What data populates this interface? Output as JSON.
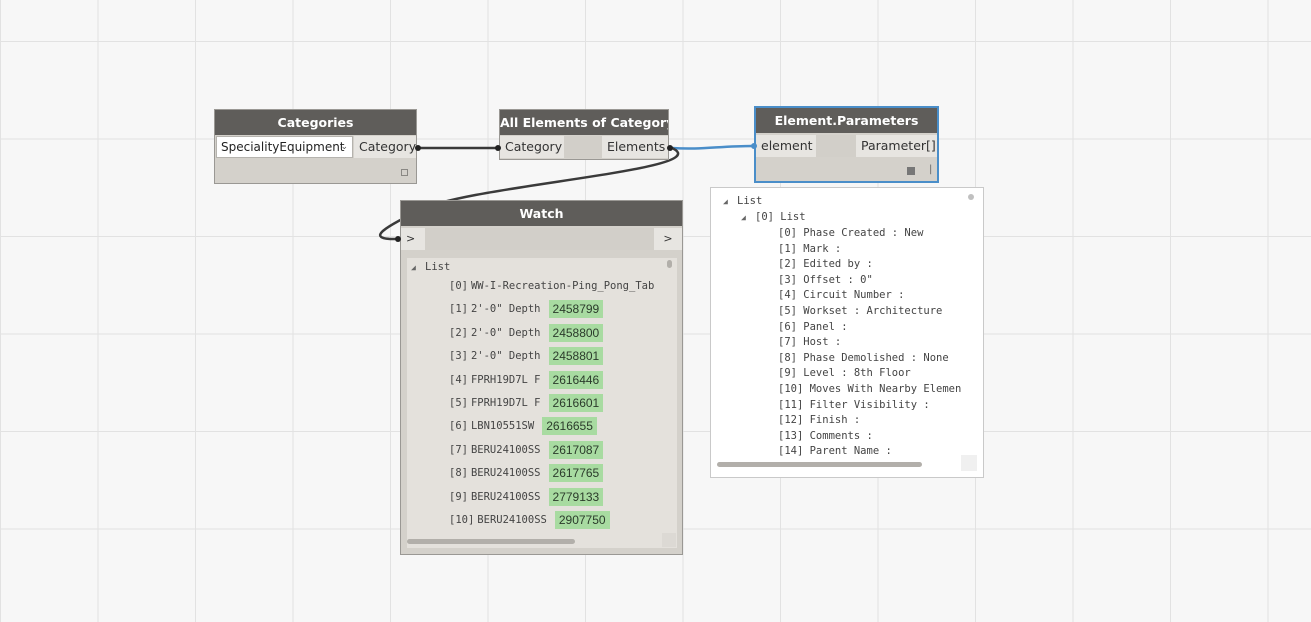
{
  "nodes": {
    "categories": {
      "title": "Categories",
      "dropdown_value": "SpecialityEquipment",
      "output_port": "Category"
    },
    "all_elements": {
      "title": "All Elements of Category",
      "input_port": "Category",
      "output_port": "Elements"
    },
    "element_parameters": {
      "title": "Element.Parameters",
      "input_port": "element",
      "output_port": "Parameter[]",
      "bar_glyph": "|"
    },
    "watch": {
      "title": "Watch",
      "input_port": ">",
      "output_port": ">",
      "list_header": "List",
      "items": [
        {
          "index": "[0]",
          "label": "WW-I-Recreation-Ping_Pong_Tab",
          "id": ""
        },
        {
          "index": "[1]",
          "label": "2'-0\" Depth",
          "id": "2458799"
        },
        {
          "index": "[2]",
          "label": "2'-0\" Depth",
          "id": "2458800"
        },
        {
          "index": "[3]",
          "label": "2'-0\" Depth",
          "id": "2458801"
        },
        {
          "index": "[4]",
          "label": "FPRH19D7L F",
          "id": "2616446"
        },
        {
          "index": "[5]",
          "label": "FPRH19D7L F",
          "id": "2616601"
        },
        {
          "index": "[6]",
          "label": "LBN10551SW",
          "id": "2616655"
        },
        {
          "index": "[7]",
          "label": "BERU24100SS",
          "id": "2617087"
        },
        {
          "index": "[8]",
          "label": "BERU24100SS",
          "id": "2617765"
        },
        {
          "index": "[9]",
          "label": "BERU24100SS",
          "id": "2779133"
        },
        {
          "index": "[10]",
          "label": "BERU24100SS",
          "id": "2907750"
        }
      ]
    }
  },
  "preview": {
    "root_label": "List",
    "sublist_label": "[0] List",
    "items": [
      "[0] Phase Created : New",
      "[1] Mark :",
      "[2] Edited by :",
      "[3] Offset : 0\"",
      "[4] Circuit Number :",
      "[5] Workset : Architecture",
      "[6] Panel :",
      "[7] Host :",
      "[8] Phase Demolished : None",
      "[9] Level : 8th Floor",
      "[10] Moves With Nearby Elemen",
      "[11] Filter Visibility :",
      "[12] Finish :",
      "[13] Comments :",
      "[14] Parent Name :"
    ]
  },
  "colors": {
    "canvas": "#f7f7f7",
    "node_header": "#5f5d5a",
    "node_body": "#d4d1cb",
    "selected_border": "#4a8ec9",
    "id_tag": "#a8dba1",
    "active_wire": "#4a8ec9",
    "wire": "#3a3a3a"
  },
  "icons": {
    "collapse": "triangle-down-icon",
    "dropdown": "chevron-down-icon",
    "preview_toggle": "square-icon"
  }
}
